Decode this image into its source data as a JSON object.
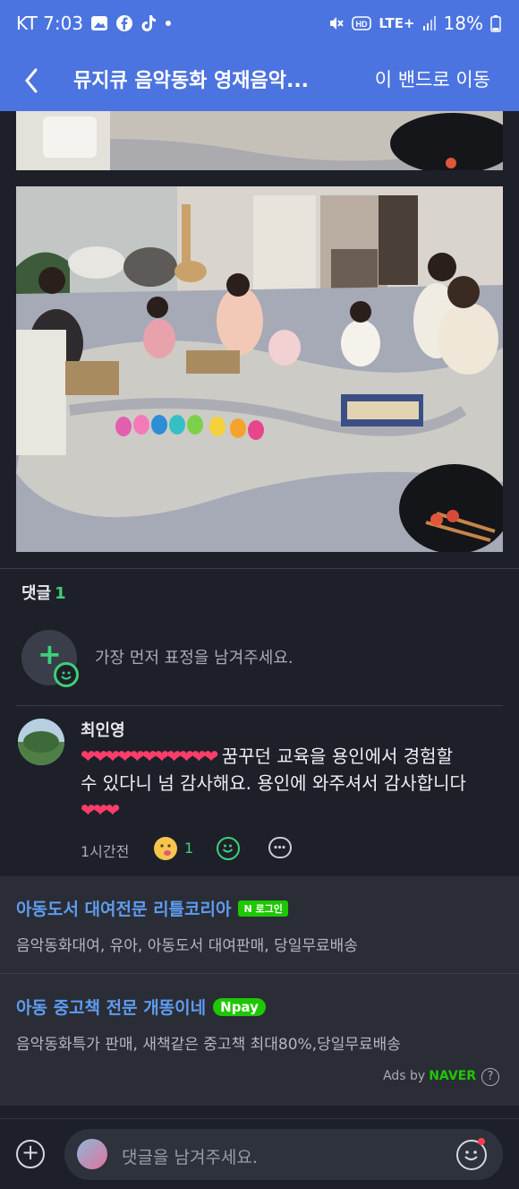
{
  "status_bar": {
    "carrier_time": "KT 7:03",
    "network": "LTE+",
    "battery": "18%",
    "icons": [
      "gallery-icon",
      "facebook-icon",
      "tiktok-icon",
      "dot-icon",
      "mute-icon",
      "hd-icon",
      "signal-icon",
      "battery-icon"
    ]
  },
  "header": {
    "title": "뮤지큐 음악동화 영재음악...",
    "goto_band": "이 밴드로 이동"
  },
  "comments": {
    "label": "댓글",
    "count": "1",
    "reaction_hint": "가장 먼저 표정을 남겨주세요.",
    "items": [
      {
        "author": "최인영",
        "hearts_lead": "❤❤❤❤❤❤❤❤❤❤❤",
        "text_lead": " 꿈꾸던 교육을 용인에서 경험할 수 있다니 넘 감사해요. 용인에 와주셔서 감사합니다 ",
        "hearts_trail": "❤❤❤",
        "time": "1시간전",
        "reaction_count": "1"
      }
    ]
  },
  "ads": [
    {
      "title": "아동도서 대여전문 리틀코리아",
      "badge": "로그인",
      "desc": "음악동화대여, 유아, 아동도서 대여판매, 당일무료배송"
    },
    {
      "title": "아동 중고책 전문 개똥이네",
      "badge": "pay",
      "desc": "음악동화특가 판매, 새책같은 중고책 최대80%,당일무료배송"
    }
  ],
  "ads_by": {
    "label": "Ads by",
    "brand": "NAVER",
    "help": "?"
  },
  "bottom_bar": {
    "placeholder": "댓글을 남겨주세요.",
    "add_symbol": "+"
  },
  "colors": {
    "header_blue": "#4c74e0",
    "accent_green": "#3ed07a",
    "heart_red": "#ff3d6b",
    "ad_link_blue": "#5f9cf0",
    "naver_green": "#1ec800"
  }
}
